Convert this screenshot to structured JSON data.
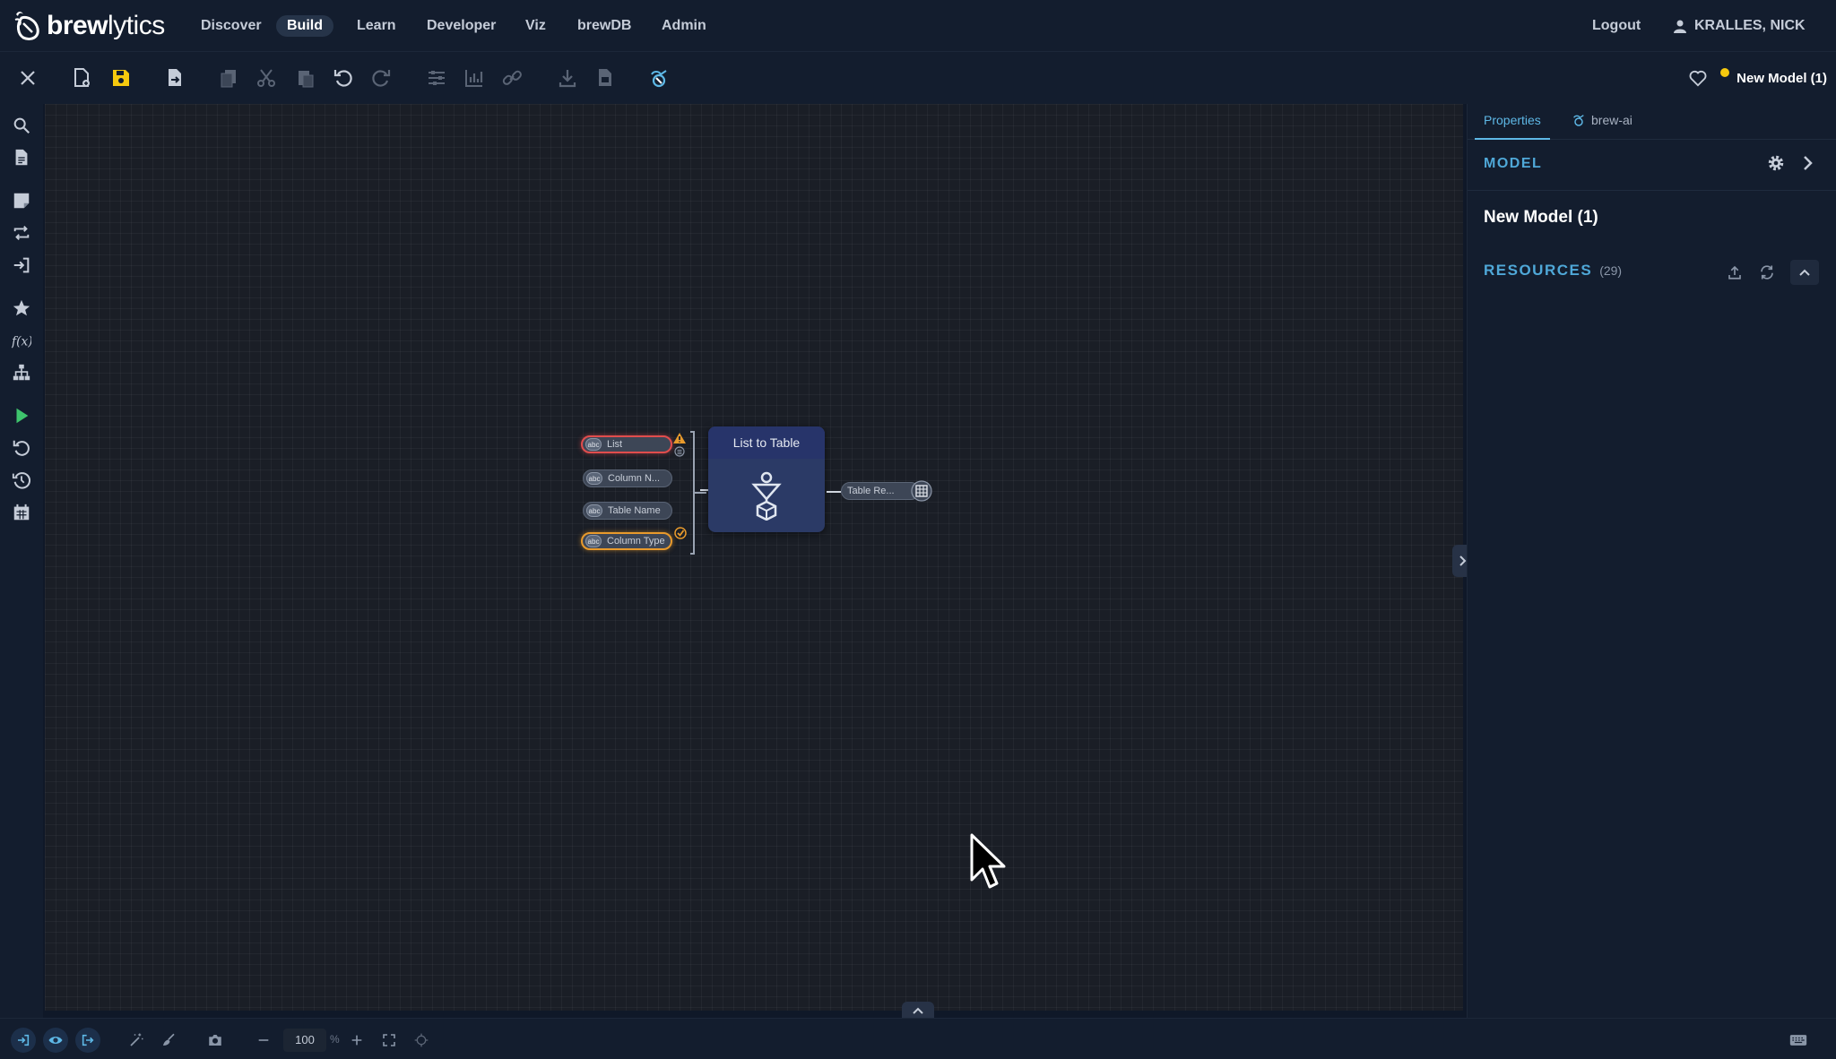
{
  "app": {
    "logo_prefix": "brew",
    "logo_suffix": "lytics"
  },
  "nav": {
    "items": [
      {
        "label": "Discover",
        "active": false
      },
      {
        "label": "Build",
        "active": true
      },
      {
        "label": "Learn",
        "active": false
      },
      {
        "label": "Developer",
        "active": false
      },
      {
        "label": "Viz",
        "active": false
      },
      {
        "label": "brewDB",
        "active": false
      },
      {
        "label": "Admin",
        "active": false
      }
    ],
    "logout": "Logout",
    "user": "KRALLES, NICK"
  },
  "toolbar": {
    "icons": [
      "close-icon",
      "new-file-icon",
      "save-icon",
      "import-icon",
      "copy-icon",
      "cut-icon",
      "paste-icon",
      "undo-icon",
      "redo-icon",
      "sliders-icon",
      "chart-icon",
      "link-icon",
      "download-icon",
      "document-icon",
      "brew-ai-icon"
    ],
    "model_title": "New Model (1)",
    "status_color": "#f6c90e"
  },
  "sidebar": {
    "icons": [
      "search-icon",
      "document-icon",
      "sticky-note-icon",
      "loop-icon",
      "login-icon",
      "star-icon",
      "function-icon",
      "hierarchy-icon",
      "play-icon",
      "reset-icon",
      "history-icon",
      "calendar-icon"
    ]
  },
  "canvas": {
    "node": {
      "title": "List to Table",
      "inputs": [
        {
          "label": "List",
          "state": "error"
        },
        {
          "label": "Column N...",
          "state": "normal"
        },
        {
          "label": "Table Name",
          "state": "normal"
        },
        {
          "label": "Column Type",
          "state": "warning"
        }
      ],
      "output": "Table Re..."
    }
  },
  "panel": {
    "tabs": [
      {
        "label": "Properties",
        "active": true
      },
      {
        "label": "brew-ai",
        "active": false
      }
    ],
    "model_heading": "MODEL",
    "model_name": "New Model (1)",
    "resources_heading": "RESOURCES",
    "resources_count": "(29)"
  },
  "bottom": {
    "zoom": "100",
    "zoom_unit": "%"
  },
  "colors": {
    "accent": "#4fa8d8",
    "background": "#0f1828",
    "canvas": "#1a1e26",
    "node": "#2b3a66",
    "error": "#e14d4d",
    "warning": "#e89a2c",
    "play": "#3ec46d"
  }
}
